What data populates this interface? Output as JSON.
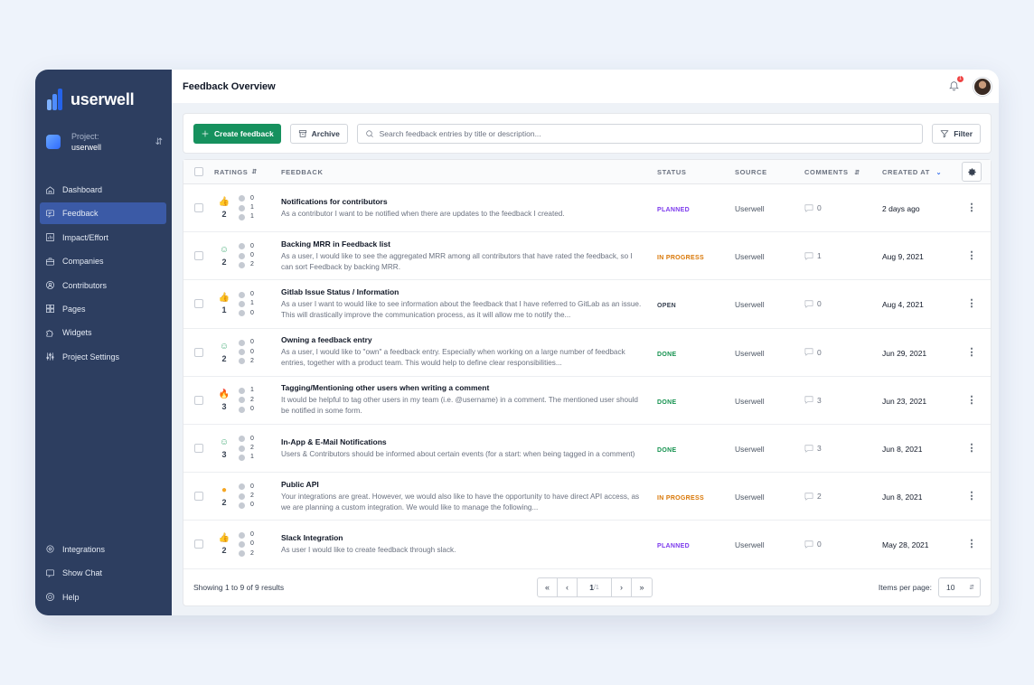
{
  "brand": {
    "name": "userwell"
  },
  "project": {
    "label": "Project:",
    "name": "userwell"
  },
  "nav": [
    {
      "label": "Dashboard",
      "icon": "home-icon",
      "active": false
    },
    {
      "label": "Feedback",
      "icon": "feedback-icon",
      "active": true
    },
    {
      "label": "Impact/Effort",
      "icon": "chart-icon",
      "active": false
    },
    {
      "label": "Companies",
      "icon": "briefcase-icon",
      "active": false
    },
    {
      "label": "Contributors",
      "icon": "user-circle-icon",
      "active": false
    },
    {
      "label": "Pages",
      "icon": "pages-icon",
      "active": false
    },
    {
      "label": "Widgets",
      "icon": "puzzle-icon",
      "active": false
    },
    {
      "label": "Project Settings",
      "icon": "sliders-icon",
      "active": false
    }
  ],
  "nav_bottom": [
    {
      "label": "Integrations",
      "icon": "gear-icon"
    },
    {
      "label": "Show Chat",
      "icon": "chat-icon"
    },
    {
      "label": "Help",
      "icon": "help-icon"
    }
  ],
  "header": {
    "title": "Feedback Overview",
    "notification_count": "1"
  },
  "toolbar": {
    "create_label": "Create feedback",
    "archive_label": "Archive",
    "search_placeholder": "Search feedback entries by title or description...",
    "filter_label": "Filter"
  },
  "columns": {
    "ratings": "RATINGS",
    "feedback": "FEEDBACK",
    "status": "STATUS",
    "source": "SOURCE",
    "comments": "COMMENTS",
    "created": "CREATED AT"
  },
  "colors": {
    "planned": "#7c3aed",
    "in_progress": "#d97706",
    "open": "#374151",
    "done": "#15924f",
    "primary": "#16915e",
    "sidebar": "#2d3e60"
  },
  "rows": [
    {
      "rating_icon": "thumbs-up-icon",
      "total": "2",
      "breakdown": [
        "0",
        "1",
        "1"
      ],
      "title": "Notifications for contributors",
      "description": "As a contributor I want to be notified when there are updates to the feedback I created.",
      "status": "PLANNED",
      "status_key": "planned",
      "source": "Userwell",
      "comments": "0",
      "created": "2 days ago"
    },
    {
      "rating_icon": "smile-icon",
      "total": "2",
      "breakdown": [
        "0",
        "0",
        "2"
      ],
      "title": "Backing MRR in Feedback list",
      "description": "As a user, I would like to see the aggregated MRR among all contributors that have rated the feedback, so I can sort Feedback by backing MRR.",
      "status": "IN PROGRESS",
      "status_key": "in_progress",
      "source": "Userwell",
      "comments": "1",
      "created": "Aug 9, 2021"
    },
    {
      "rating_icon": "thumbs-up-icon",
      "total": "1",
      "breakdown": [
        "0",
        "1",
        "0"
      ],
      "title": "Gitlab Issue Status / Information",
      "description": "As a user I want to would like to see information about the feedback that I have referred to GitLab as an issue. This will drastically improve the communication process, as it will allow me to notify the...",
      "status": "OPEN",
      "status_key": "open",
      "source": "Userwell",
      "comments": "0",
      "created": "Aug 4, 2021"
    },
    {
      "rating_icon": "smile-icon",
      "total": "2",
      "breakdown": [
        "0",
        "0",
        "2"
      ],
      "title": "Owning a feedback entry",
      "description": "As a user, I would like to \"own\" a feedback entry. Especially when working on a large number of feedback entries, together with a product team. This would help to define clear responsibilities...",
      "status": "DONE",
      "status_key": "done",
      "source": "Userwell",
      "comments": "0",
      "created": "Jun 29, 2021"
    },
    {
      "rating_icon": "fire-icon",
      "total": "3",
      "breakdown": [
        "1",
        "2",
        "0"
      ],
      "title": "Tagging/Mentioning other users when writing a comment",
      "description": "It would be helpful to tag other users in my team (i.e. @username) in a comment. The mentioned user should be notified in some form.",
      "status": "DONE",
      "status_key": "done",
      "source": "Userwell",
      "comments": "3",
      "created": "Jun 23, 2021"
    },
    {
      "rating_icon": "smile-icon",
      "total": "3",
      "breakdown": [
        "0",
        "2",
        "1"
      ],
      "title": "In-App & E-Mail Notifications",
      "description": "Users & Contributors should be informed about certain events (for a start: when being tagged in a comment)",
      "status": "DONE",
      "status_key": "done",
      "source": "Userwell",
      "comments": "3",
      "created": "Jun 8, 2021"
    },
    {
      "rating_icon": "neutral-face-icon",
      "total": "2",
      "breakdown": [
        "0",
        "2",
        "0"
      ],
      "title": "Public API",
      "description": "Your integrations are great. However, we would also like to have the opportunity to have direct API access, as we are planning a custom integration. We would like to manage the following...",
      "status": "IN PROGRESS",
      "status_key": "in_progress",
      "source": "Userwell",
      "comments": "2",
      "created": "Jun 8, 2021"
    },
    {
      "rating_icon": "thumbs-up-icon",
      "total": "2",
      "breakdown": [
        "0",
        "0",
        "2"
      ],
      "title": "Slack Integration",
      "description": "As user I would like to create feedback through slack.",
      "status": "PLANNED",
      "status_key": "planned",
      "source": "Userwell",
      "comments": "0",
      "created": "May 28, 2021"
    }
  ],
  "footer": {
    "results_text": "Showing 1 to 9 of 9 results",
    "current_page": "1",
    "total_pages": "/1",
    "items_per_page_label": "Items per page:",
    "items_per_page": "10"
  }
}
